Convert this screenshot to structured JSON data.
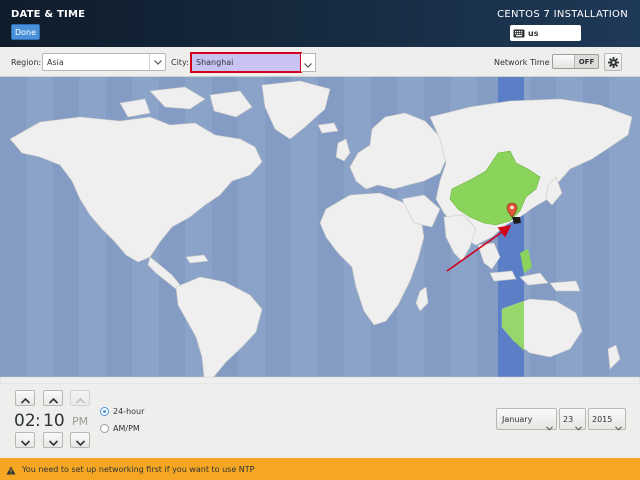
{
  "header": {
    "title": "DATE & TIME",
    "done_label": "Done",
    "install_title": "CENTOS 7 INSTALLATION",
    "keyboard_layout": "us"
  },
  "location": {
    "region_label": "Region:",
    "region_value": "Asia",
    "city_label": "City:",
    "city_value": "Shanghai"
  },
  "network_time": {
    "label": "Network Time",
    "state": "OFF"
  },
  "map": {
    "selected_city": "Shanghai",
    "highlight_color": "#8bd45b",
    "ocean_color": "#8ca3c9",
    "land_color": "#efefef",
    "selected_zone_color": "#5b7fc6",
    "annotation_arrow_color": "#d0021b"
  },
  "time": {
    "hours": "02",
    "separator": ":",
    "minutes": "10",
    "period": "PM",
    "format_24h_label": "24-hour",
    "format_ampm_label": "AM/PM",
    "selected_format": "24-hour"
  },
  "date": {
    "month": "January",
    "day": "23",
    "year": "2015"
  },
  "warning": {
    "text": "You need to set up networking first if you want to use NTP",
    "color": "#f5a623"
  },
  "icons": [
    "keyboard-icon",
    "gear-icon",
    "chevron-down-icon",
    "chevron-up-icon",
    "warning-icon",
    "location-pin-icon"
  ]
}
